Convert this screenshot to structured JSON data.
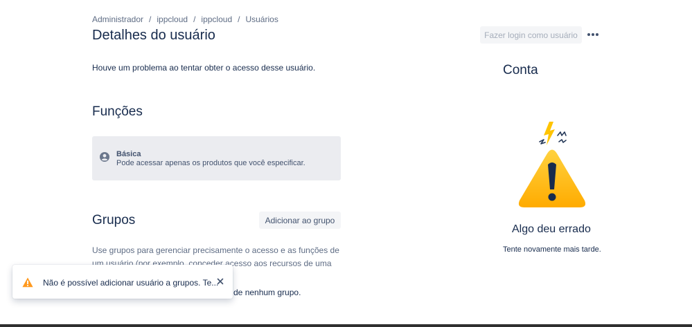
{
  "breadcrumb": {
    "items": [
      "Administrador",
      "ippcloud",
      "ippcloud",
      "Usuários"
    ],
    "separator": "/"
  },
  "header": {
    "title": "Detalhes do usuário",
    "login_as_label": "Fazer login como usuário",
    "more_icon": "more-horizontal-icon"
  },
  "access": {
    "error_message": "Houve um problema ao tentar obter o acesso desse usuário."
  },
  "roles": {
    "title": "Funções",
    "role_name": "Básica",
    "role_description": "Pode acessar apenas os produtos que você especificar.",
    "role_icon": "user-avatar-icon"
  },
  "groups": {
    "title": "Grupos",
    "add_label": "Adicionar ao grupo",
    "description": "Use grupos para gerenciar precisamente o acesso e as funções de um usuário (por exemplo, conceder acesso aos recursos de uma equipe ou",
    "empty_text": "o de nenhum grupo."
  },
  "account": {
    "title": "Conta",
    "error_title": "Algo deu errado",
    "error_subtitle": "Tente novamente mais tarde.",
    "illustration": "warning-triangle-illustration"
  },
  "toast": {
    "message": "Não é possível adicionar usuário a grupos. Te...",
    "icon": "warning-icon",
    "close_icon": "close-icon"
  },
  "colors": {
    "text_primary": "#172b4d",
    "text_subtle": "#5e6c84",
    "card_bg": "#ebecf0",
    "button_bg": "#f4f5f7",
    "warning": "#ffab00"
  }
}
